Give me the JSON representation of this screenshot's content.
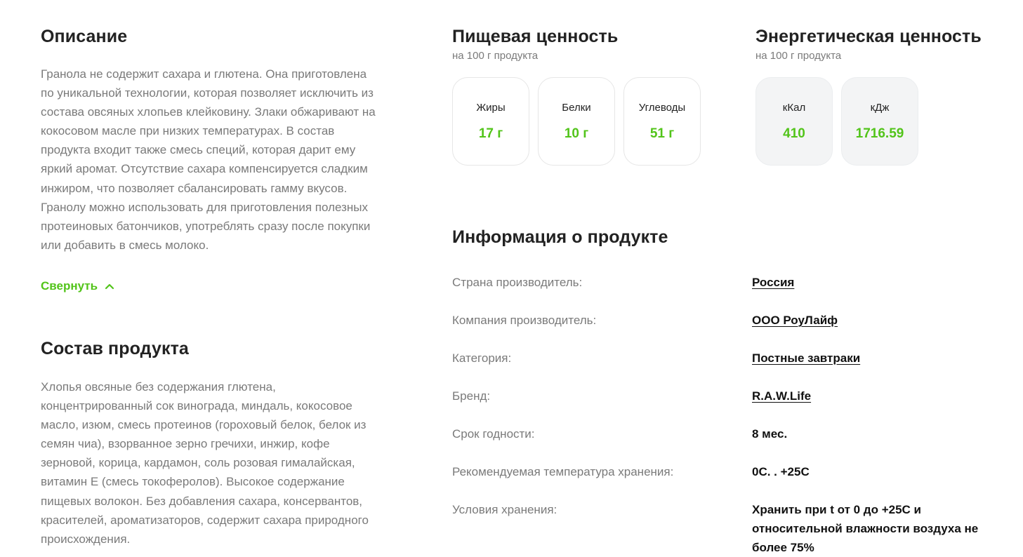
{
  "description": {
    "title": "Описание",
    "text": "Гранола не содержит сахара и глютена. Она приготовлена по уникальной технологии, которая позволяет исключить из состава овсяных хлопьев клейковину. Злаки обжаривают на кокосовом масле при низких температурах. В состав продукта входит также смесь специй, которая дарит ему яркий аромат. Отсутствие сахара компенсируется сладким инжиром, что позволяет сбалансировать гамму вкусов. Гранолу можно использовать для приготовления полезных протеиновых батончиков, употреблять сразу после покупки или добавить в смесь молоко.",
    "collapse_label": "Свернуть",
    "collapse_icon": "chevron-up-icon"
  },
  "composition": {
    "title": "Состав продукта",
    "text": "Хлопья овсяные без содержания глютена, концентрированный сок винограда, миндаль, кокосовое масло, изюм, смесь протеинов (гороховый белок, белок из семян чиа), взорванное зерно гречихи, инжир, кофе зерновой, корица, кардамон, соль розовая гималайская, витамин Е (смесь токоферолов). Высокое содержание пищевых волокон. Без добавления сахара, консервантов, красителей, ароматизаторов, содержит сахара природного происхождения."
  },
  "nutrition": {
    "title": "Пищевая ценность",
    "subtitle": "на 100 г продукта",
    "items": [
      {
        "label": "Жиры",
        "value": "17 г"
      },
      {
        "label": "Белки",
        "value": "10 г"
      },
      {
        "label": "Углеводы",
        "value": "51 г"
      }
    ]
  },
  "energy": {
    "title": "Энергетическая ценность",
    "subtitle": "на 100 г продукта",
    "items": [
      {
        "label": "кКал",
        "value": "410"
      },
      {
        "label": "кДж",
        "value": "1716.59"
      }
    ]
  },
  "info": {
    "title": "Информация о продукте",
    "rows": [
      {
        "key": "Страна производитель:",
        "value": "Россия"
      },
      {
        "key": "Компания производитель:",
        "value": "ООО РоуЛайф"
      },
      {
        "key": "Категория:",
        "value": "Постные завтраки"
      },
      {
        "key": "Бренд:",
        "value": "R.A.W.Life"
      },
      {
        "key": "Срок годности:",
        "value": "8 мес."
      },
      {
        "key": "Рекомендуемая температура хранения:",
        "value": "0С. . +25С"
      },
      {
        "key": "Условия хранения:",
        "value": "Хранить при t от 0 до +25С и относительной влажности воздуха не более 75%"
      }
    ]
  },
  "colors": {
    "accent": "#52c41a",
    "muted_text": "#7a7a7a",
    "heading": "#222222"
  }
}
